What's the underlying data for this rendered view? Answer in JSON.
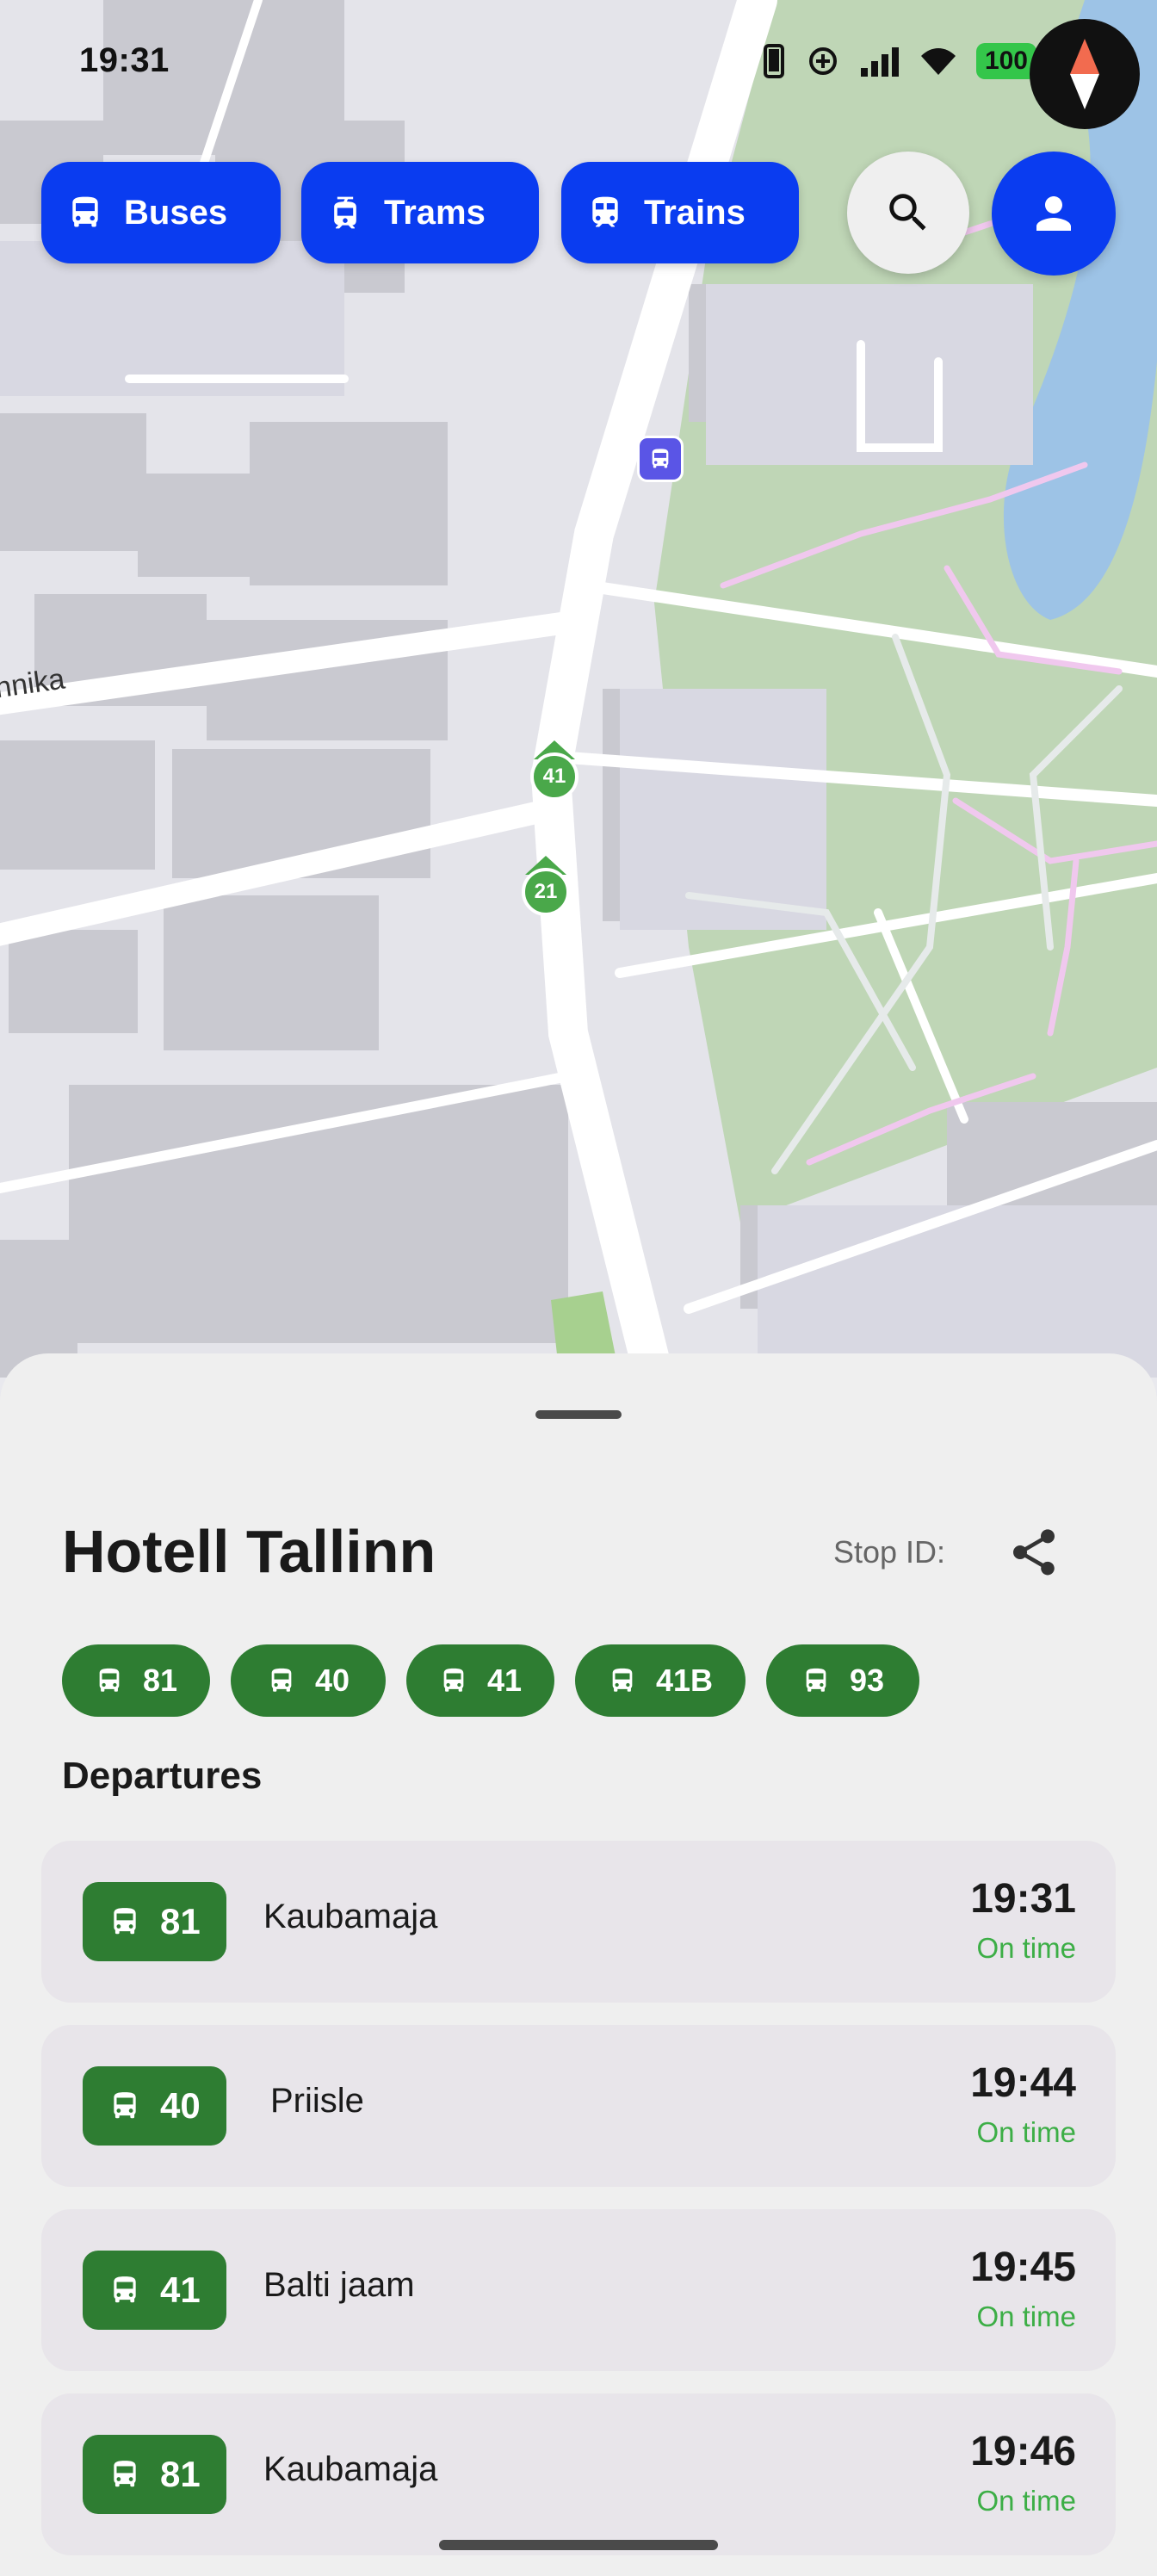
{
  "status_bar": {
    "time": "19:31",
    "battery": "100"
  },
  "map": {
    "street_label": "nnika",
    "route_markers": [
      "41",
      "21"
    ]
  },
  "filters": [
    {
      "label": "Buses",
      "icon": "bus-icon"
    },
    {
      "label": "Trams",
      "icon": "tram-icon"
    },
    {
      "label": "Trains",
      "icon": "train-icon"
    }
  ],
  "colors": {
    "accent": "#0a3cf0",
    "route_green": "#2e7d32",
    "on_time": "#3cae46"
  },
  "stop": {
    "name": "Hotell Tallinn",
    "stop_id_label": "Stop ID:",
    "lines": [
      "81",
      "40",
      "41",
      "41B",
      "93"
    ]
  },
  "departures_title": "Departures",
  "departures": [
    {
      "line": "81",
      "destination": "Kaubamaja",
      "time": "19:31",
      "status": "On time"
    },
    {
      "line": "40",
      "destination": "Priisle",
      "time": "19:44",
      "status": "On time"
    },
    {
      "line": "41",
      "destination": "Balti jaam",
      "time": "19:45",
      "status": "On time"
    },
    {
      "line": "81",
      "destination": "Kaubamaja",
      "time": "19:46",
      "status": "On time"
    }
  ]
}
